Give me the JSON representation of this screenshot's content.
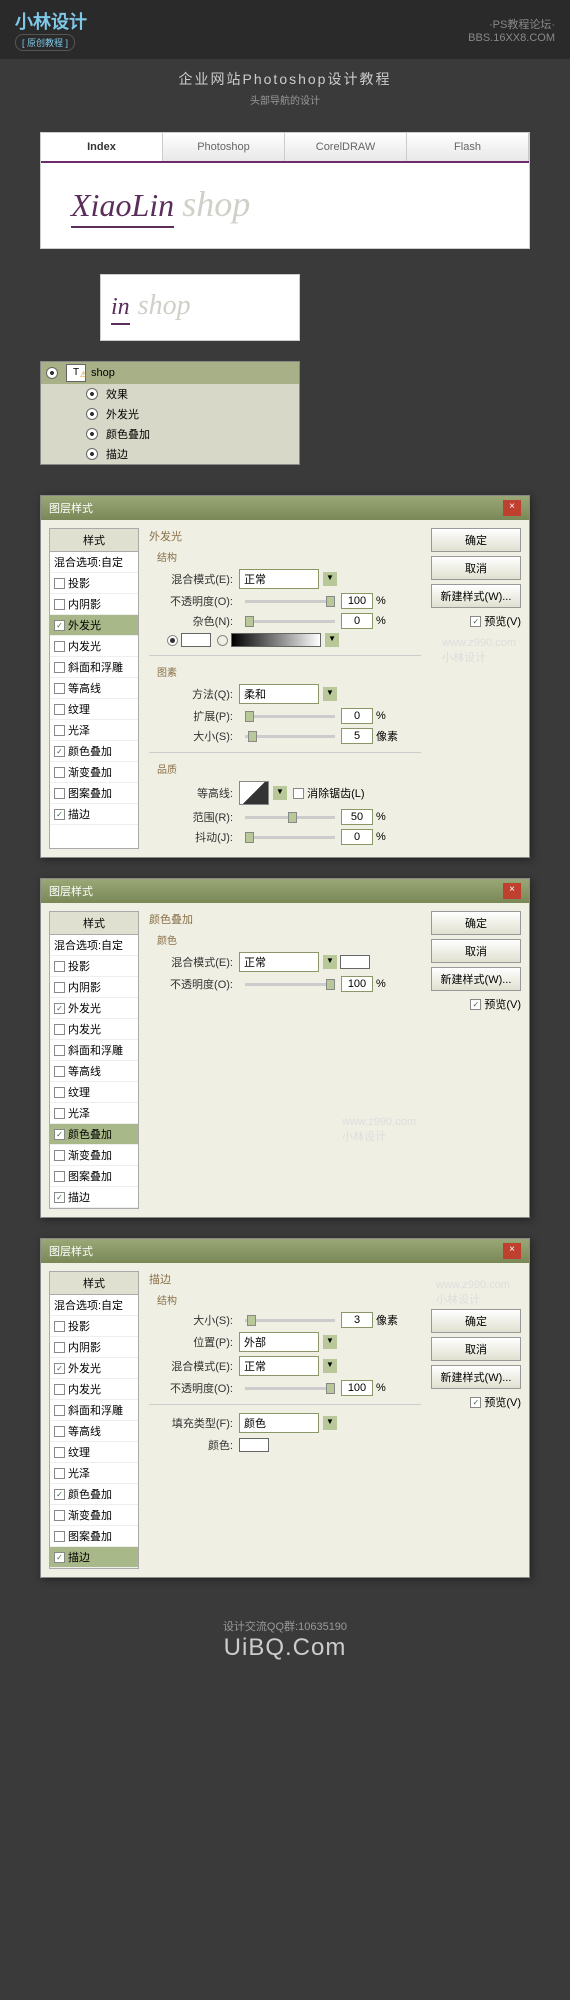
{
  "header": {
    "logo": "小林设计",
    "logo_sub": "[ 原创教程 ]",
    "right1": "·PS教程论坛·",
    "right2": "BBS.16XX8.COM"
  },
  "title": {
    "main": "企业网站Photoshop设计教程",
    "sub": "头部导航的设计"
  },
  "nav": {
    "tabs": [
      "Index",
      "Photoshop",
      "CorelDRAW",
      "Flash"
    ]
  },
  "logo_text": {
    "xiaolin": "XiaoLin",
    "shop": "shop",
    "partial": "in"
  },
  "layers": {
    "layer_name": "shop",
    "effects": "效果",
    "items": [
      "外发光",
      "颜色叠加",
      "描边"
    ]
  },
  "dialog_title": "图层样式",
  "styles": {
    "header": "样式",
    "blend_opts": "混合选项:自定",
    "items": [
      {
        "label": "投影",
        "checked": false
      },
      {
        "label": "内阴影",
        "checked": false
      },
      {
        "label": "外发光",
        "checked": true
      },
      {
        "label": "内发光",
        "checked": false
      },
      {
        "label": "斜面和浮雕",
        "checked": false
      },
      {
        "label": "等高线",
        "checked": false
      },
      {
        "label": "纹理",
        "checked": false
      },
      {
        "label": "光泽",
        "checked": false
      },
      {
        "label": "颜色叠加",
        "checked": true
      },
      {
        "label": "渐变叠加",
        "checked": false
      },
      {
        "label": "图案叠加",
        "checked": false
      },
      {
        "label": "描边",
        "checked": true
      }
    ]
  },
  "buttons": {
    "ok": "确定",
    "cancel": "取消",
    "new_style": "新建样式(W)...",
    "preview": "预览(V)"
  },
  "panel1": {
    "title": "外发光",
    "struct": "结构",
    "blend_mode": "混合模式(E):",
    "blend_val": "正常",
    "opacity": "不透明度(O):",
    "opacity_val": "100",
    "noise": "杂色(N):",
    "noise_val": "0",
    "elements": "图素",
    "method": "方法(Q):",
    "method_val": "柔和",
    "spread": "扩展(P):",
    "spread_val": "0",
    "size": "大小(S):",
    "size_val": "5",
    "px": "像素",
    "quality": "品质",
    "contour": "等高线:",
    "anti": "消除锯齿(L)",
    "range": "范围(R):",
    "range_val": "50",
    "jitter": "抖动(J):",
    "jitter_val": "0",
    "pct": "%"
  },
  "panel2": {
    "title": "颜色叠加",
    "color": "颜色",
    "blend_mode": "混合模式(E):",
    "blend_val": "正常",
    "opacity": "不透明度(O):",
    "opacity_val": "100",
    "pct": "%"
  },
  "panel3": {
    "title": "描边",
    "struct": "结构",
    "size": "大小(S):",
    "size_val": "3",
    "px": "像素",
    "position": "位置(P):",
    "position_val": "外部",
    "blend_mode": "混合模式(E):",
    "blend_val": "正常",
    "opacity": "不透明度(O):",
    "opacity_val": "100",
    "pct": "%",
    "fill_type": "填充类型(F):",
    "fill_val": "颜色",
    "color": "颜色:"
  },
  "watermark": {
    "url": "www.z990.com",
    "name": "小林设计"
  },
  "footer": {
    "qq": "设计交流QQ群:10635190",
    "site": "UiBQ.Com"
  }
}
